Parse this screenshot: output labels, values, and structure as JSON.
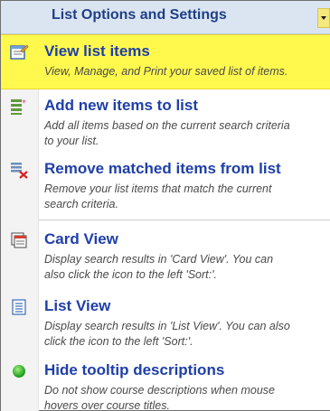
{
  "menu": {
    "title": "List Options and Settings",
    "items": [
      {
        "label": "View list items",
        "description": "View, Manage, and Print your saved list of items.",
        "icon": "view-list-icon",
        "active": true
      },
      {
        "label": "Add new items to list",
        "description": "Add all items based on the current search criteria\nto your list.",
        "icon": "add-items-icon"
      },
      {
        "label": "Remove matched items from list",
        "description": "Remove your list items that match the current\nsearch criteria.",
        "icon": "remove-items-icon"
      },
      {
        "label": "Card View",
        "description": "Display search results in 'Card View'. You can\nalso click the icon to the left 'Sort:'.",
        "icon": "card-view-icon"
      },
      {
        "label": "List View",
        "description": "Display search results in 'List View'. You can also\nclick the icon to the left 'Sort:'.",
        "icon": "list-view-icon"
      },
      {
        "label": "Hide tooltip descriptions",
        "description": "Do not show course descriptions when mouse\nhovers over course titles.",
        "icon": "green-dot-icon"
      }
    ]
  },
  "colors": {
    "header_bg": "#dbe5f1",
    "title_blue": "#1f3f86",
    "label_blue": "#1f3fa8",
    "active_bg": "#fff94d"
  }
}
